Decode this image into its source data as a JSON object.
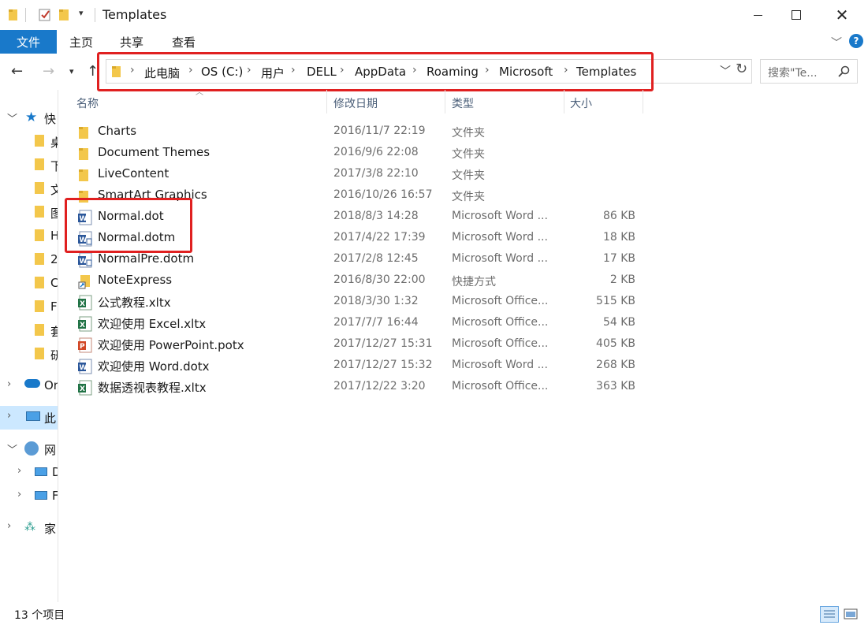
{
  "window": {
    "title": "Templates"
  },
  "ribbon": {
    "file_tab": "文件",
    "tabs": [
      "主页",
      "共享",
      "查看"
    ]
  },
  "breadcrumb": [
    "此电脑",
    "OS (C:)",
    "用户",
    "DELL",
    "AppData",
    "Roaming",
    "Microsoft",
    "Templates"
  ],
  "search": {
    "placeholder": "搜索\"Te..."
  },
  "columns": {
    "name": "名称",
    "date": "修改日期",
    "type": "类型",
    "size": "大小"
  },
  "nav": {
    "quick_access": "快",
    "onedrive": "On",
    "this_pc": "此",
    "network": "网",
    "homegroup": "家",
    "sub_items": [
      "桌",
      "下",
      "文",
      "图",
      "H",
      "2",
      "C",
      "F",
      "套",
      "研"
    ],
    "net_items": [
      "D",
      "F"
    ]
  },
  "files": [
    {
      "name": "Charts",
      "date": "2016/11/7 22:19",
      "type": "文件夹",
      "size": "",
      "icon": "folder-icon"
    },
    {
      "name": "Document Themes",
      "date": "2016/9/6 22:08",
      "type": "文件夹",
      "size": "",
      "icon": "folder-icon"
    },
    {
      "name": "LiveContent",
      "date": "2017/3/8 22:10",
      "type": "文件夹",
      "size": "",
      "icon": "folder-icon"
    },
    {
      "name": "SmartArt Graphics",
      "date": "2016/10/26 16:57",
      "type": "文件夹",
      "size": "",
      "icon": "folder-icon"
    },
    {
      "name": "Normal.dot",
      "date": "2018/8/3 14:28",
      "type": "Microsoft Word ...",
      "size": "86 KB",
      "icon": "word-template-icon"
    },
    {
      "name": "Normal.dotm",
      "date": "2017/4/22 17:39",
      "type": "Microsoft Word ...",
      "size": "18 KB",
      "icon": "word-macro-template-icon"
    },
    {
      "name": "NormalPre.dotm",
      "date": "2017/2/8 12:45",
      "type": "Microsoft Word ...",
      "size": "17 KB",
      "icon": "word-macro-template-icon"
    },
    {
      "name": "NoteExpress",
      "date": "2016/8/30 22:00",
      "type": "快捷方式",
      "size": "2 KB",
      "icon": "shortcut-icon"
    },
    {
      "name": "公式教程.xltx",
      "date": "2018/3/30 1:32",
      "type": "Microsoft Office...",
      "size": "515 KB",
      "icon": "excel-template-icon"
    },
    {
      "name": "欢迎使用 Excel.xltx",
      "date": "2017/7/7 16:44",
      "type": "Microsoft Office...",
      "size": "54 KB",
      "icon": "excel-template-icon"
    },
    {
      "name": "欢迎使用 PowerPoint.potx",
      "date": "2017/12/27 15:31",
      "type": "Microsoft Office...",
      "size": "405 KB",
      "icon": "powerpoint-template-icon"
    },
    {
      "name": "欢迎使用 Word.dotx",
      "date": "2017/12/27 15:32",
      "type": "Microsoft Word ...",
      "size": "268 KB",
      "icon": "word-template-icon"
    },
    {
      "name": "数据透视表教程.xltx",
      "date": "2017/12/22 3:20",
      "type": "Microsoft Office...",
      "size": "363 KB",
      "icon": "excel-template-icon"
    }
  ],
  "status": {
    "item_count": "13 个项目"
  },
  "colors": {
    "accent": "#1979ca",
    "highlight": "#e02020",
    "selection": "#cce8ff",
    "folder": "#f3c74b"
  }
}
